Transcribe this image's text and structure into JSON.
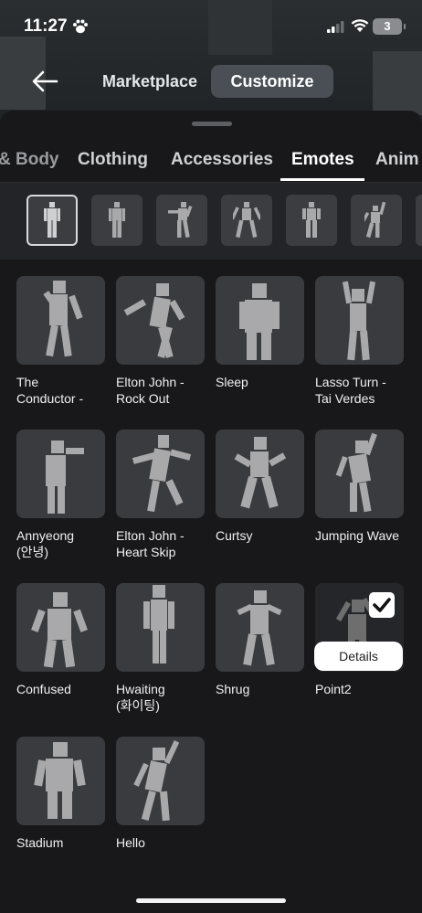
{
  "status": {
    "time": "11:27",
    "battery": "3"
  },
  "nav": {
    "tabs": [
      "Marketplace",
      "Customize"
    ],
    "active": "Customize"
  },
  "categories": [
    "& Body",
    "Clothing",
    "Accessories",
    "Emotes",
    "Anim"
  ],
  "active_category": "Emotes",
  "emotes": [
    {
      "name": "The\nConductor -",
      "pose": "conductor"
    },
    {
      "name": "Elton John -\nRock Out",
      "pose": "rockout"
    },
    {
      "name": "Sleep",
      "pose": "sleep"
    },
    {
      "name": "Lasso Turn -\nTai Verdes",
      "pose": "lasso"
    },
    {
      "name": "Annyeong\n(안녕)",
      "pose": "annyeong"
    },
    {
      "name": "Elton John -\nHeart Skip",
      "pose": "heartskip"
    },
    {
      "name": "Curtsy",
      "pose": "curtsy"
    },
    {
      "name": "Jumping Wave",
      "pose": "jumpwave"
    },
    {
      "name": "Confused",
      "pose": "confused"
    },
    {
      "name": "Hwaiting\n(화이팅)",
      "pose": "hwaiting"
    },
    {
      "name": "Shrug",
      "pose": "shrug"
    },
    {
      "name": "Point2",
      "pose": "point2",
      "selected": true
    },
    {
      "name": "Stadium",
      "pose": "stadium"
    },
    {
      "name": "Hello",
      "pose": "hello"
    }
  ],
  "details_label": "Details",
  "colors": {
    "figure": "#a9a9ab",
    "tile": "#3a3b3f",
    "sheet": "#18181b"
  }
}
